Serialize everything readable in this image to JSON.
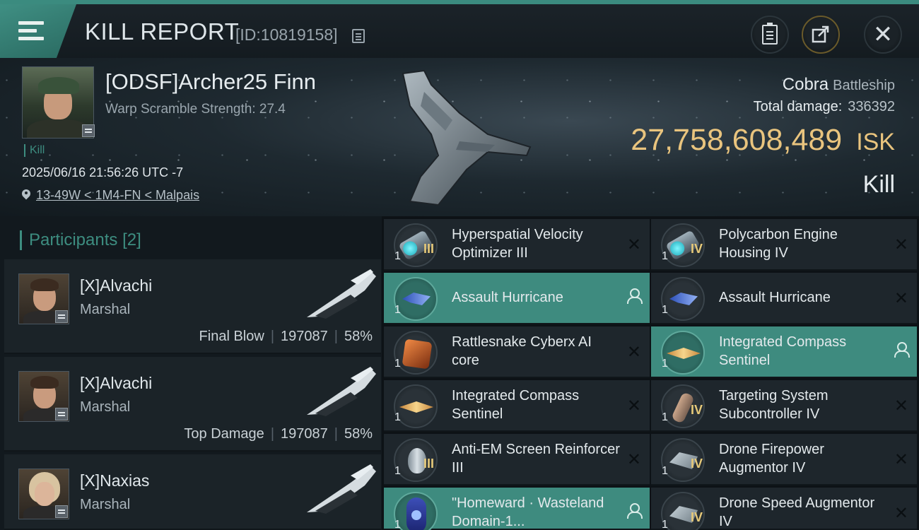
{
  "header": {
    "title": "KILL REPORT",
    "report_id": "[ID:10819158]"
  },
  "victim": {
    "name": "[ODSF]Archer25 Finn",
    "scramble": "Warp Scramble Strength: 27.4",
    "kill_tag": "Kill",
    "datetime": "2025/06/16 21:56:26 UTC -7",
    "location": "13-49W < 1M4-FN < Malpais",
    "ship_name": "Cobra",
    "ship_class": "Battleship",
    "total_damage_label": "Total damage:",
    "total_damage": "336392",
    "isk_value": "27,758,608,489",
    "isk_unit": "ISK",
    "result_label": "Kill"
  },
  "participants": {
    "label": "Participants",
    "count": "[2]",
    "rows": [
      {
        "name": "[X]Alvachi",
        "corp": "Marshal",
        "role": "Final Blow",
        "damage": "197087",
        "percent": "58%"
      },
      {
        "name": "[X]Alvachi",
        "corp": "Marshal",
        "role": "Top Damage",
        "damage": "197087",
        "percent": "58%"
      },
      {
        "name": "[X]Naxias",
        "corp": "Marshal",
        "role": "",
        "damage": "",
        "percent": ""
      }
    ]
  },
  "items": [
    {
      "name": "Hyperspatial Velocity Optimizer III",
      "qty": "1",
      "level": "III",
      "icon": "rig-icon",
      "highlight": false
    },
    {
      "name": "Polycarbon Engine Housing IV",
      "qty": "1",
      "level": "IV",
      "icon": "rig-icon",
      "highlight": false
    },
    {
      "name": "Assault Hurricane",
      "qty": "1",
      "level": "",
      "icon": "drone-icon",
      "highlight": true
    },
    {
      "name": "Assault Hurricane",
      "qty": "1",
      "level": "",
      "icon": "drone-icon",
      "highlight": false
    },
    {
      "name": "Rattlesnake Cyberx AI core",
      "qty": "1",
      "level": "",
      "icon": "ai-core-icon",
      "highlight": false
    },
    {
      "name": "Integrated Compass Sentinel",
      "qty": "1",
      "level": "",
      "icon": "sentinel-icon",
      "highlight": true
    },
    {
      "name": "Integrated Compass Sentinel",
      "qty": "1",
      "level": "",
      "icon": "sentinel-icon",
      "highlight": false
    },
    {
      "name": "Targeting System Subcontroller IV",
      "qty": "1",
      "level": "IV",
      "icon": "subcontroller-icon",
      "highlight": false
    },
    {
      "name": "Anti-EM Screen Reinforcer III",
      "qty": "1",
      "level": "III",
      "icon": "shield-reinforcer-icon",
      "highlight": false
    },
    {
      "name": "Drone Firepower Augmentor IV",
      "qty": "1",
      "level": "IV",
      "icon": "augmentor-icon",
      "highlight": false
    },
    {
      "name": "\"Homeward · Wasteland Domain-1...",
      "qty": "1",
      "level": "",
      "icon": "token-icon",
      "highlight": true
    },
    {
      "name": "Drone Speed Augmentor IV",
      "qty": "1",
      "level": "IV",
      "icon": "augmentor-icon",
      "highlight": false
    }
  ]
}
